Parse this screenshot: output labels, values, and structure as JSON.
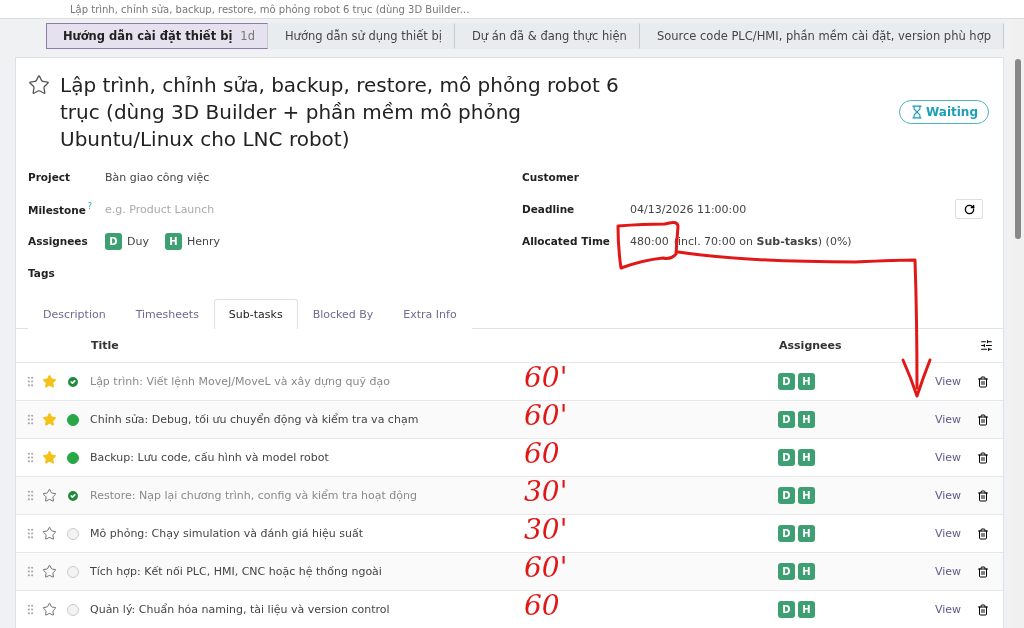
{
  "breadcrumb": "Lập trình, chỉnh sửa, backup, restore, mô phỏng robot 6 trục (dùng 3D Builder...",
  "stages": [
    {
      "label": "Hướng dẫn cài đặt thiết bị",
      "duration": "1d",
      "selected": true
    },
    {
      "label": "Hướng dẫn sử dụng thiết bị",
      "selected": false
    },
    {
      "label": "Dự án đã & đang thực hiện",
      "selected": false
    },
    {
      "label": "Source code PLC/HMI, phần mềm cài đặt, version phù hợp",
      "selected": false
    }
  ],
  "task": {
    "title": "Lập trình, chỉnh sửa, backup, restore, mô phỏng robot 6 trục (dùng 3D Builder + phần mềm mô phỏng Ubuntu/Linux cho LNC robot)",
    "starred": false,
    "status": "Waiting"
  },
  "fields_left": [
    {
      "label": "Project",
      "value": "Bàn giao công việc"
    },
    {
      "label": "Milestone",
      "help": "?",
      "placeholder": "e.g. Product Launch"
    },
    {
      "label": "Assignees",
      "people": [
        {
          "initial": "D",
          "name": "Duy"
        },
        {
          "initial": "H",
          "name": "Henry"
        }
      ]
    },
    {
      "label": "Tags"
    }
  ],
  "fields_right": [
    {
      "label": "Customer"
    },
    {
      "label": "Deadline",
      "value": "04/13/2026 11:00:00",
      "refresh": true
    },
    {
      "label": "Allocated Time",
      "value": "480:00",
      "detail": "(incl. 70:00 on **Sub-tasks**) (0%)"
    }
  ],
  "tabs": [
    {
      "label": "Description",
      "selected": false
    },
    {
      "label": "Timesheets",
      "selected": false
    },
    {
      "label": "Sub-tasks",
      "selected": true
    },
    {
      "label": "Blocked By",
      "selected": false
    },
    {
      "label": "Extra Info",
      "selected": false
    }
  ],
  "table": {
    "columns": [
      "Title",
      "Assignees"
    ],
    "rows": [
      {
        "title": "Lập trình: Viết lệnh MoveJ/MoveL và xây dựng quỹ đạo",
        "starred": true,
        "kind": "done",
        "assignees": [
          "D",
          "H"
        ],
        "action": "View",
        "note": "60'"
      },
      {
        "title": "Chỉnh sửa: Debug, tối ưu chuyển động và kiểm tra va chạm",
        "starred": true,
        "kind": "approved",
        "assignees": [
          "D",
          "H"
        ],
        "action": "View",
        "note": "60'"
      },
      {
        "title": "Backup: Lưu code, cấu hình và model robot",
        "starred": true,
        "kind": "approved",
        "assignees": [
          "D",
          "H"
        ],
        "action": "View",
        "note": "60"
      },
      {
        "title": "Restore: Nạp lại chương trình, config và kiểm tra hoạt động",
        "starred": false,
        "kind": "done",
        "assignees": [
          "D",
          "H"
        ],
        "action": "View",
        "note": "30'"
      },
      {
        "title": "Mô phỏng: Chạy simulation và đánh giá hiệu suất",
        "starred": false,
        "kind": "in_progress",
        "assignees": [
          "D",
          "H"
        ],
        "action": "View",
        "note": "30'"
      },
      {
        "title": "Tích hợp: Kết nối PLC, HMI, CNC hoặc hệ thống ngoài",
        "starred": false,
        "kind": "in_progress",
        "assignees": [
          "D",
          "H"
        ],
        "action": "View",
        "note": "60'"
      },
      {
        "title": "Quản lý: Chuẩn hóa naming, tài liệu và version control",
        "starred": false,
        "kind": "in_progress",
        "assignees": [
          "D",
          "H"
        ],
        "action": "View",
        "note": "60"
      }
    ]
  }
}
